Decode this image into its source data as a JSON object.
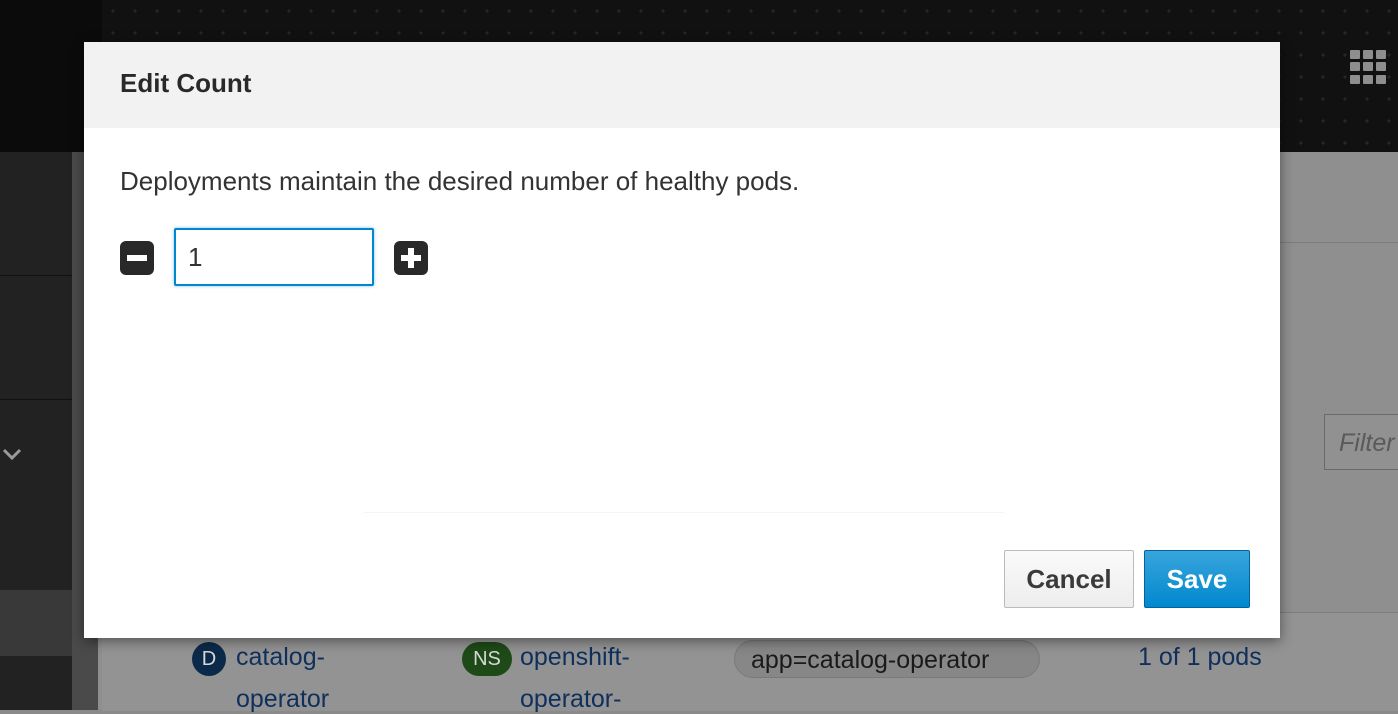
{
  "modal": {
    "title": "Edit Count",
    "description": "Deployments maintain the desired number of healthy pods.",
    "count_value": "1",
    "cancel_label": "Cancel",
    "save_label": "Save"
  },
  "background": {
    "filter_placeholder": "Filter",
    "row": {
      "deployment_badge": "D",
      "deployment_name_line1": "catalog-",
      "deployment_name_line2": "operator",
      "namespace_badge": "NS",
      "namespace_name_line1": "openshift-",
      "namespace_name_line2": "operator-",
      "label": "app=catalog-operator",
      "status": "1 of 1 pods"
    }
  },
  "colors": {
    "primary_blue": "#0088ce",
    "masthead": "#0b0b0b",
    "modal_header": "#f2f2f2"
  },
  "icons": [
    "app-launcher-icon",
    "chevron-down-icon",
    "minus-square-icon",
    "plus-square-icon"
  ]
}
